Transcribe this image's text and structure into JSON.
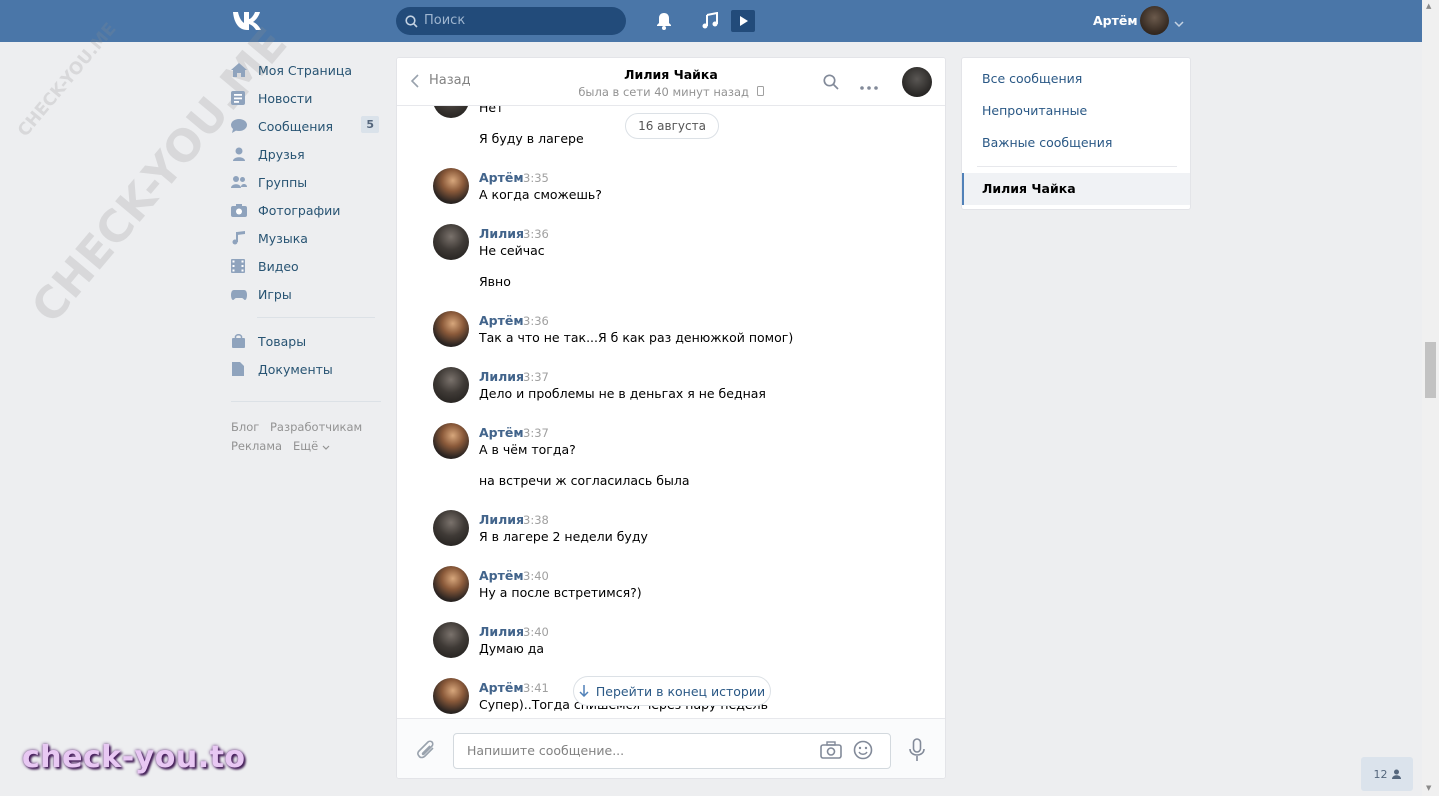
{
  "header": {
    "logo": "VK",
    "search_placeholder": "Поиск",
    "user_name": "Артём"
  },
  "left_menu": {
    "items": [
      {
        "label": "Моя Страница",
        "icon": "home-icon"
      },
      {
        "label": "Новости",
        "icon": "news-icon"
      },
      {
        "label": "Сообщения",
        "icon": "messages-icon",
        "badge": "5"
      },
      {
        "label": "Друзья",
        "icon": "friends-icon"
      },
      {
        "label": "Группы",
        "icon": "groups-icon"
      },
      {
        "label": "Фотографии",
        "icon": "camera-icon"
      },
      {
        "label": "Музыка",
        "icon": "music-icon"
      },
      {
        "label": "Видео",
        "icon": "video-icon"
      },
      {
        "label": "Игры",
        "icon": "games-icon"
      }
    ],
    "items2": [
      {
        "label": "Товары",
        "icon": "bag-icon"
      },
      {
        "label": "Документы",
        "icon": "document-icon"
      }
    ],
    "footer": {
      "blog": "Блог",
      "developers": "Разработчикам",
      "ads": "Реклама",
      "more": "Ещё"
    }
  },
  "chat": {
    "back": "Назад",
    "peer_name": "Лилия Чайка",
    "peer_status": "была в сети 40 минут назад",
    "date_separator": "16 августа",
    "messages": [
      {
        "author": "",
        "time": "",
        "lines": [
          "Нет",
          "Я буду в лагере"
        ]
      },
      {
        "author": "Артём",
        "time": "3:35",
        "lines": [
          "А когда сможешь?"
        ]
      },
      {
        "author": "Лилия",
        "time": "3:36",
        "lines": [
          "Не сейчас",
          "Явно"
        ]
      },
      {
        "author": "Артём",
        "time": "3:36",
        "lines": [
          "Так а что не так...Я б как раз денюжкой помог)"
        ]
      },
      {
        "author": "Лилия",
        "time": "3:37",
        "lines": [
          "Дело и проблемы не в деньгах я не бедная"
        ]
      },
      {
        "author": "Артём",
        "time": "3:37",
        "lines": [
          "А в чём тогда?",
          "на встречи ж согласилась была"
        ]
      },
      {
        "author": "Лилия",
        "time": "3:38",
        "lines": [
          "Я в лагере 2 недели буду"
        ]
      },
      {
        "author": "Артём",
        "time": "3:40",
        "lines": [
          "Ну а после встретимся?)"
        ]
      },
      {
        "author": "Лилия",
        "time": "3:40",
        "lines": [
          "Думаю да"
        ]
      },
      {
        "author": "Артём",
        "time": "3:41",
        "lines": [
          "Супер)..Тогда спишемся через пару недель"
        ]
      }
    ],
    "jump_to_end": "Перейти в конец истории",
    "input_placeholder": "Напишите сообщение..."
  },
  "right_panel": {
    "all": "Все сообщения",
    "unread": "Непрочитанные",
    "important": "Важные сообщения",
    "active": "Лилия Чайка"
  },
  "online_count": "12",
  "watermark": {
    "small": "CHECK-YOU.ME",
    "large": "CHECK-YOU.ME",
    "brand": "check-you.to"
  },
  "colors": {
    "header": "#4a76a8",
    "link": "#2a5885",
    "author": "#42648b",
    "background": "#edeef0"
  }
}
